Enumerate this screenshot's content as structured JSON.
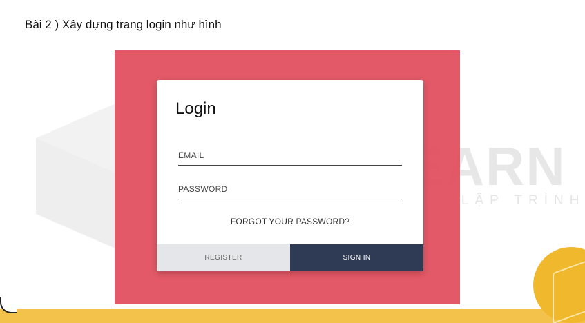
{
  "slide": {
    "heading": "Bài 2 ) Xây dựng trang login như hình"
  },
  "watermark": {
    "brand": "CYBERLEARN",
    "tagline": "ĐÀO TẠO CHUYÊN GIA LẬP TRÌNH"
  },
  "login": {
    "title": "Login",
    "email_placeholder": "EMAIL",
    "password_placeholder": "PASSWORD",
    "forgot_label": "FORGOT YOUR PASSWORD?",
    "register_label": "REGISTER",
    "signin_label": "SIGN IN"
  },
  "colors": {
    "panel": "#e25261",
    "signin_button": "#2f3a55",
    "register_button": "#e4e6ea",
    "accent_yellow": "#f3c24a"
  }
}
